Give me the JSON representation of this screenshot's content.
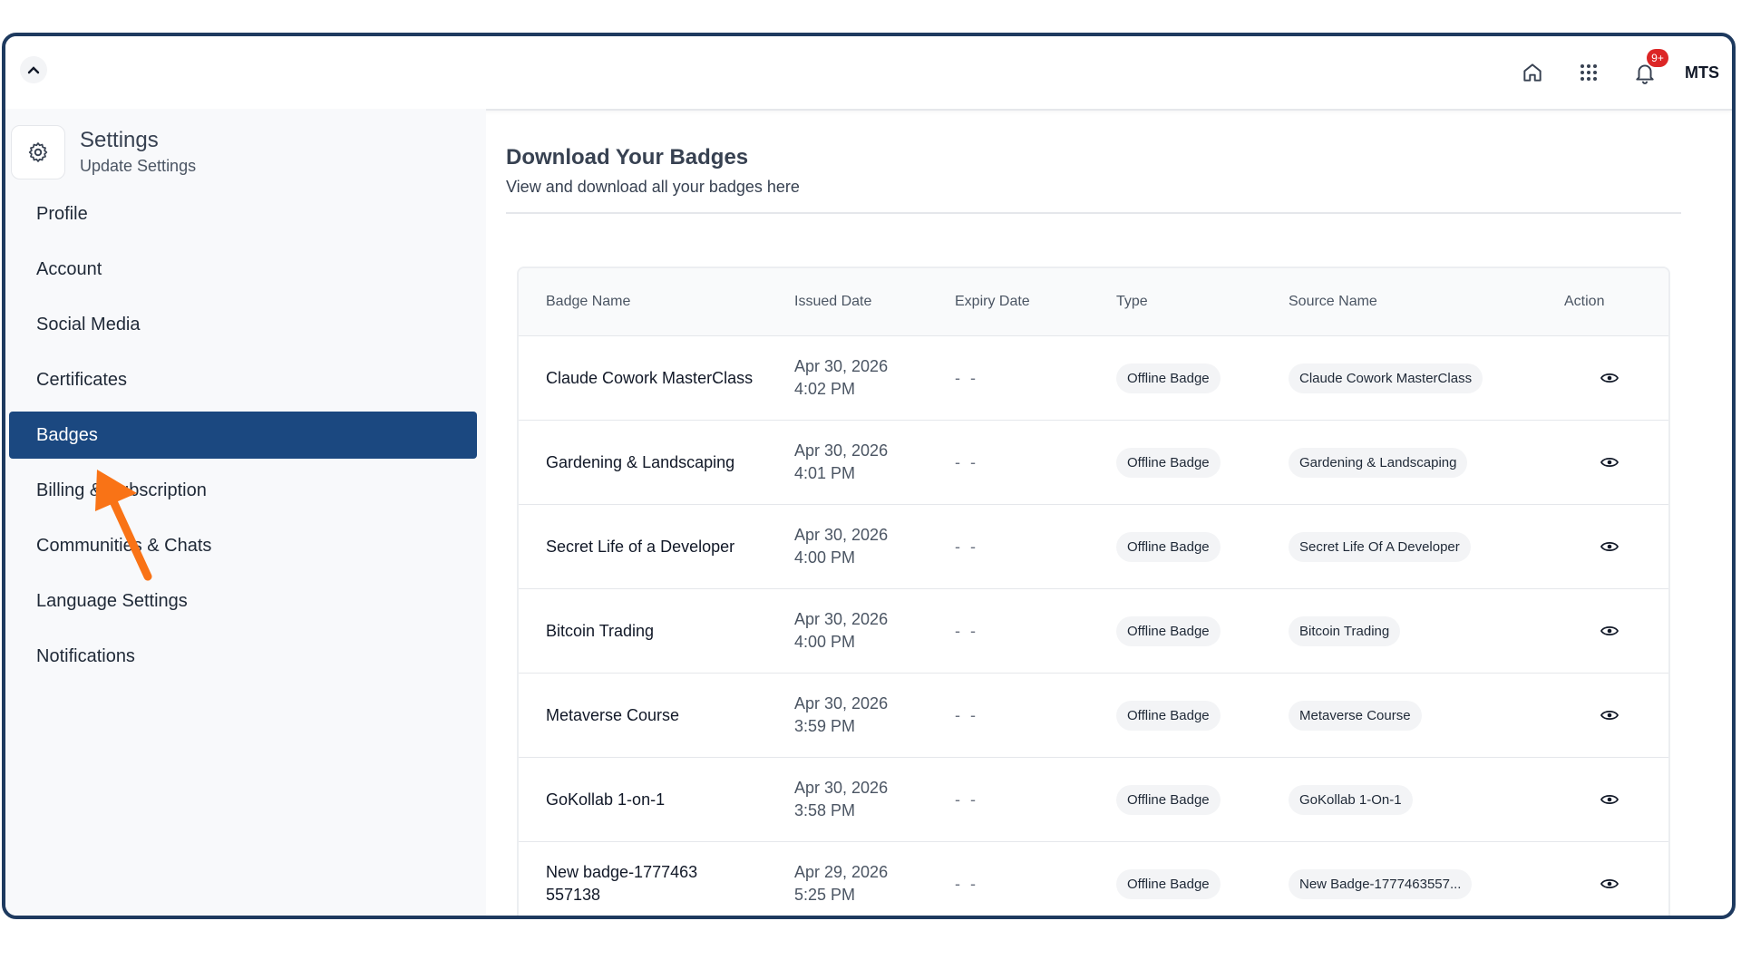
{
  "topbar": {
    "notification_count": "9+",
    "user_initials": "MTS"
  },
  "sidebar": {
    "title": "Settings",
    "subtitle": "Update Settings",
    "items": [
      {
        "label": "Profile"
      },
      {
        "label": "Account"
      },
      {
        "label": "Social Media"
      },
      {
        "label": "Certificates"
      },
      {
        "label": "Badges",
        "active": true
      },
      {
        "label": "Billing & Subscription"
      },
      {
        "label": "Communities & Chats"
      },
      {
        "label": "Language Settings"
      },
      {
        "label": "Notifications"
      }
    ]
  },
  "main": {
    "title": "Download Your Badges",
    "subtitle": "View and download all your badges here",
    "table": {
      "headers": [
        "Badge Name",
        "Issued Date",
        "Expiry Date",
        "Type",
        "Source Name",
        "Action"
      ],
      "rows": [
        {
          "name": "Claude Cowork MasterClass",
          "issued_date": "Apr 30, 2026",
          "issued_time": "4:02 PM",
          "expiry": "- -",
          "type": "Offline Badge",
          "source": "Claude Cowork MasterClass"
        },
        {
          "name": "Gardening & Landscaping",
          "issued_date": "Apr 30, 2026",
          "issued_time": "4:01 PM",
          "expiry": "- -",
          "type": "Offline Badge",
          "source": "Gardening & Landscaping"
        },
        {
          "name": "Secret Life of a Developer",
          "issued_date": "Apr 30, 2026",
          "issued_time": "4:00 PM",
          "expiry": "- -",
          "type": "Offline Badge",
          "source": "Secret Life Of A Developer"
        },
        {
          "name": "Bitcoin Trading",
          "issued_date": "Apr 30, 2026",
          "issued_time": "4:00 PM",
          "expiry": "- -",
          "type": "Offline Badge",
          "source": "Bitcoin Trading"
        },
        {
          "name": "Metaverse Course",
          "issued_date": "Apr 30, 2026",
          "issued_time": "3:59 PM",
          "expiry": "- -",
          "type": "Offline Badge",
          "source": "Metaverse Course"
        },
        {
          "name": "GoKollab 1-on-1",
          "issued_date": "Apr 30, 2026",
          "issued_time": "3:58 PM",
          "expiry": "- -",
          "type": "Offline Badge",
          "source": "GoKollab 1-On-1"
        },
        {
          "name": "New badge-1777463557138",
          "issued_date": "Apr 29, 2026",
          "issued_time": "5:25 PM",
          "expiry": "- -",
          "type": "Offline Badge",
          "source": "New Badge-1777463557..."
        }
      ]
    }
  },
  "colors": {
    "frame": "#1e3a5f",
    "active_nav": "#1b4880",
    "notification": "#dc2626",
    "annotation_arrow": "#f97316"
  }
}
